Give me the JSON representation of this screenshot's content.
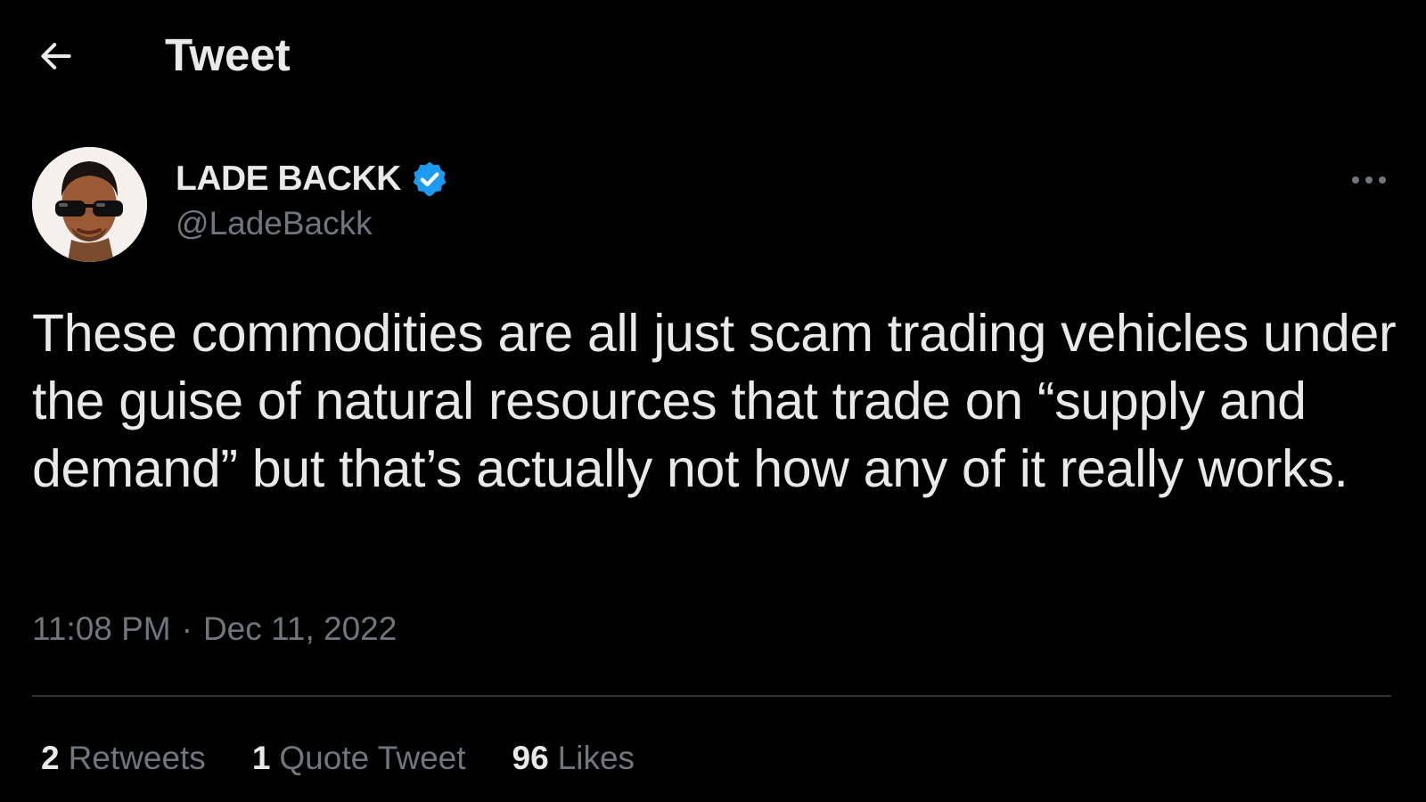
{
  "header": {
    "title": "Tweet",
    "back_icon": "arrow-left-icon"
  },
  "author": {
    "name": "LADE BACKK",
    "handle": "@LadeBackk",
    "verified": true,
    "verified_icon": "verified-badge-icon",
    "verified_color": "#1d9bf0"
  },
  "more_icon": "more-horizontal-icon",
  "tweet": {
    "text": "These commodities are all just scam trading vehicles under the guise of natural resources that trade on “supply and demand” but that’s actually not how any of it really works.",
    "time": "11:08 PM",
    "separator": "·",
    "date": "Dec 11, 2022"
  },
  "stats": {
    "retweets_count": "2",
    "retweets_label": "Retweets",
    "quotes_count": "1",
    "quotes_label": "Quote Tweet",
    "likes_count": "96",
    "likes_label": "Likes"
  },
  "colors": {
    "background": "#000000",
    "primary_text": "#e7e9ea",
    "secondary_text": "#71767b",
    "divider": "#2f3336"
  }
}
